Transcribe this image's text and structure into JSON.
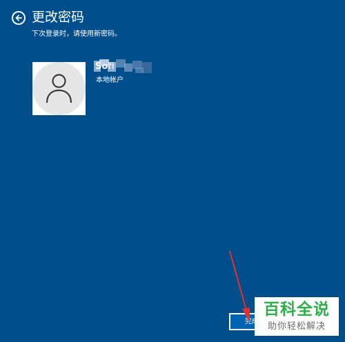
{
  "header": {
    "title": "更改密码",
    "subtitle": "下次登录时，请使用新密码。",
    "back_icon": "back-arrow-icon"
  },
  "account": {
    "username": "Sofi",
    "type": "本地帐户",
    "avatar_icon": "user-silhouette-icon"
  },
  "actions": {
    "finish_label": "完成"
  },
  "watermark": {
    "title": "百科全说",
    "subtitle": "助你轻松解决"
  },
  "colors": {
    "background": "#004e8c",
    "button": "#0063b1",
    "annotation_arrow": "#e8302a",
    "watermark_green": "#2bb04a"
  }
}
